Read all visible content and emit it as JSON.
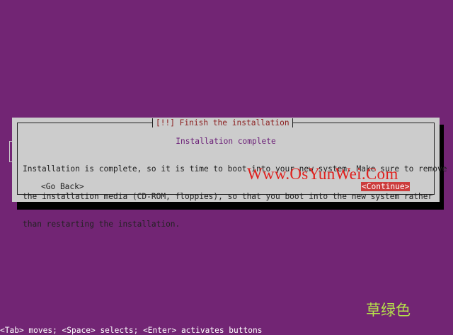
{
  "dialog": {
    "title": "[!!] Finish the installation",
    "section_title": "Installation complete",
    "message_lines": [
      "Installation is complete, so it is time to boot into your new system. Make sure to remove",
      "the installation media (CD-ROM, floppies), so that you boot into the new system rather",
      "than restarting the installation."
    ],
    "go_back_label": "<Go Back>",
    "continue_label": "<Continue>"
  },
  "watermark": {
    "url": "Www.OsYunWei.Com",
    "logo": "草绿色"
  },
  "footer": {
    "help_text": "<Tab> moves; <Space> selects; <Enter> activates buttons"
  },
  "colors": {
    "background": "#722574",
    "dialog": "#cccccc",
    "title_text": "#8b1f1f",
    "button_selected": "#cc3d3d",
    "watermark_url": "#e0201d",
    "watermark_logo": "#b5e24a"
  }
}
